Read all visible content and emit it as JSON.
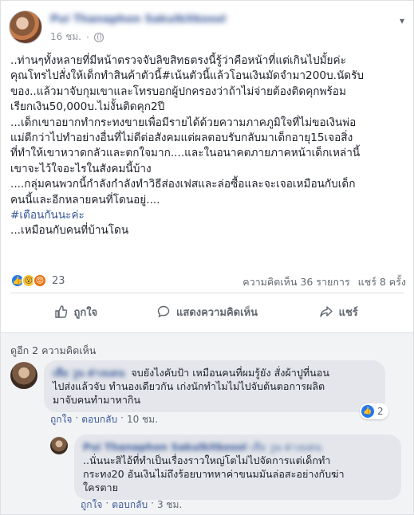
{
  "post": {
    "author": "Pui Thanaphon Sakulkitkosol",
    "time": "16 ชม.",
    "privacy_icon": "globe-icon",
    "options_icon": "chevron-down-icon",
    "lines": [
      "..ท่านๆทั้งหลายที่มีหน้าตรวจจับลิขสิทธตรงนี้รู้ว่าคือหน้าที่แต่เกินไปมั้ยค่ะ",
      "คุณโทรไปสั่งให้เด็กทำสินค้าตัวนี้#เน้นตัวนี้แล้วโอนเงินมัดจำมา200บ.นัดรับ",
      "ของ..แล้วมาจับกุมเขาและโทรบอกผู้ปกครองว่าถ้าไม่จ่ายต้องติดคุกพร้อม",
      "เรียกเงิน50,000บ.ไม่งั้นติดคุก2ปี",
      "...เด็กเขาอยากทำกระทงขายเพื่อมีรายได้ด้วยความภาคภูมิใจที่ไม่ขอเงินพ่อ",
      "แม่ดีกว่าไปทำอย่างอื่นที่ไม่ดีต่อสังคมแต่ผลตอบรับกลับมาเด็กอายุ15เจอสิ่ง",
      "ที่ทำให้เขาหวาดกลัวและตกใจมาก....และในอนาคตภายภาคหน้าเด็กเหล่านี้",
      "เขาจะไว้ใจอะไรในสังคมนี้บ้าง",
      "....กลุ่มคนพวกนี้กำลังกำลังทำวิธีส่องเฟสและล่อซื้อและจะเจอเหมือนกับเด็ก",
      "คนนี้และอีกหลายคนที่โดนอยู่...."
    ],
    "hashtag": "#เตือนกันนะค่ะ",
    "last_line": "...เหมือนกับคนที่บ้านโดน"
  },
  "reactions": {
    "count": "23",
    "comments": "ความคิดเห็น 36 รายการ",
    "shares": "แชร์ 8 ครั้ง",
    "types": [
      "like-icon",
      "wow-icon",
      "angry-icon"
    ]
  },
  "actions": {
    "like": "ถูกใจ",
    "comment": "แสดงความคิดเห็น",
    "share": "แชร์"
  },
  "comments_section": {
    "see_more": "ดูอีก 2 ความคิดเห็น",
    "comments": [
      {
        "name": "เสือ วูน ต่างแดน",
        "lines": [
          "จบยังไงคับป้า เหมือนคนที่ผมรู้ยัง สั่งผ้าปูที่นอน",
          "ไปส่งแล้วจับ ทำนองเดียวกัน เก่งนักทำไมไม่ไปจับต้นตอการผลิต",
          "มาจับคนทำมาหากิน"
        ],
        "like": "ถูกใจ",
        "reply": "ตอบกลับ",
        "time": "10 ชม.",
        "likes": "2"
      },
      {
        "name": "Pui Thanaphon Sakulkitkosol",
        "tag": "เสือ วูน ต่างแดน",
        "lines": [
          "..นั่นนะสิไอ้ที่ทำเป็นเรื่องราวใหญ่โตไม่ไปจัดการแต่เด็กทำ",
          "กระทง20 อันเงินไม่ถึงร้อยบาทหาค่าขนมมันล่อสะอย่างกับฆ่า",
          "ใครตาย"
        ],
        "like": "ถูกใจ",
        "reply": "ตอบกลับ",
        "time": "3 ชม."
      }
    ]
  }
}
